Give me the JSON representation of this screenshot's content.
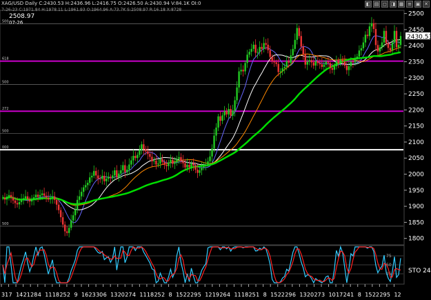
{
  "header": {
    "title": "XAG/USD  Daily  C:2430.53  H:2436.96  L:2416.75  O:2426.50  A:2430.94  V:84.1K  OI:0",
    "sub": "7-26-23  C:1971.84  H:1978.11  L:1961.93  O:1964.96  A:73.7K  S:2508.97  R:16.18  X:8728",
    "buttons": [
      "◧",
      "▤",
      "◻",
      "◨",
      "▦",
      "≡",
      "▣",
      "✕"
    ]
  },
  "cursor_readout": {
    "value": "2508.97",
    "date": "07-26"
  },
  "chart_data": [
    {
      "type": "line",
      "ylim": [
        1780,
        2510
      ],
      "y_ticks": [
        1800,
        1850,
        1900,
        1950,
        2000,
        2050,
        2100,
        2150,
        2200,
        2250,
        2300,
        2350,
        2400,
        2450,
        2500
      ],
      "last_price": "2430.53",
      "x_tick_labels": [
        "31",
        "7",
        "14",
        "21",
        "28",
        "4",
        "11",
        "18",
        "25",
        "2",
        "9",
        "16",
        "23",
        "30",
        "6",
        "13",
        "20",
        "27",
        "4",
        "11",
        "18",
        "25",
        "2",
        "8",
        "15",
        "22",
        "29",
        "5",
        "12",
        "19",
        "26",
        "4",
        "11",
        "18",
        "25",
        "1",
        "8",
        "15",
        "22",
        "29",
        "6",
        "13",
        "20",
        "27",
        "3",
        "10",
        "17",
        "24",
        "1",
        "8",
        "15",
        "22",
        "29",
        "5",
        "12"
      ],
      "candles_close": [
        1927,
        1921,
        1930,
        1935,
        1928,
        1918,
        1910,
        1906,
        1913,
        1920,
        1925,
        1931,
        1922,
        1915,
        1920,
        1928,
        1936,
        1929,
        1935,
        1940,
        1933,
        1927,
        1921,
        1926,
        1931,
        1920,
        1905,
        1888,
        1866,
        1843,
        1822,
        1817,
        1833,
        1856,
        1872,
        1890,
        1920,
        1931,
        1945,
        1959,
        1966,
        1973,
        1990,
        1995,
        2010,
        1996,
        1986,
        1985,
        1995,
        1978,
        1986,
        1992,
        1988,
        1996,
        2012,
        1990,
        2002,
        2012,
        2028,
        2006,
        2014,
        2030,
        2043,
        2057,
        2050,
        2060,
        2075,
        2093,
        2078,
        2071,
        2063,
        2054,
        2040,
        2042,
        2030,
        2033,
        2047,
        2038,
        2029,
        2025,
        2036,
        2045,
        2032,
        2036,
        2047,
        2053,
        2041,
        2034,
        2021,
        2029,
        2022,
        2034,
        2027,
        2014,
        2004,
        2012,
        2021,
        2026,
        2030,
        2040,
        2055,
        2080,
        2120,
        2145,
        2180,
        2166,
        2183,
        2196,
        2186,
        2203,
        2182,
        2198,
        2230,
        2270,
        2320,
        2325,
        2320,
        2346,
        2372,
        2381,
        2390,
        2403,
        2378,
        2380,
        2396,
        2390,
        2408,
        2403,
        2386,
        2365,
        2352,
        2348,
        2343,
        2318,
        2320,
        2330,
        2334,
        2352,
        2347,
        2370,
        2390,
        2418,
        2455,
        2430,
        2397,
        2374,
        2341,
        2350,
        2355,
        2348,
        2338,
        2352,
        2346,
        2342,
        2334,
        2341,
        2350,
        2346,
        2330,
        2325,
        2336,
        2352,
        2345,
        2356,
        2351,
        2338,
        2324,
        2336,
        2350,
        2348,
        2358,
        2366,
        2385,
        2392,
        2410,
        2434,
        2430,
        2460,
        2470,
        2452,
        2402,
        2382,
        2395,
        2410,
        2446,
        2408,
        2393,
        2385,
        2410,
        2446,
        2395,
        2402,
        2430
      ],
      "moving_averages": [
        {
          "period_hint": "short",
          "color": "#6666ff"
        },
        {
          "period_hint": "mid",
          "color": "#ffffff"
        },
        {
          "period_hint": "long",
          "color": "#ff8800"
        },
        {
          "period_hint": "slow",
          "color": "#00dd00"
        }
      ],
      "horizontal_levels": [
        {
          "value": 2352,
          "color": "#cc00cc",
          "label": "618"
        },
        {
          "value": 2196,
          "color": "#cc00cc",
          "label": "272"
        },
        {
          "value": 2076,
          "color": "#ffffff",
          "label": "000"
        },
        {
          "value": 2468,
          "color": "#888888",
          "label": "500"
        },
        {
          "value": 2279,
          "color": "#888888",
          "label": "500"
        },
        {
          "value": 2127,
          "color": "#888888",
          "label": "500"
        },
        {
          "value": 1838,
          "color": "#888888",
          "label": "500"
        }
      ]
    },
    {
      "type": "line",
      "title": "STO",
      "label": "STO  24.",
      "ylim": [
        0,
        100
      ],
      "levels": [
        75,
        50,
        25
      ]
    }
  ]
}
